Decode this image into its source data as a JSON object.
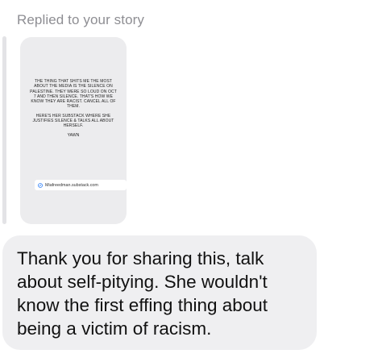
{
  "reply_header": "Replied to your story",
  "story": {
    "paragraphs": [
      "THE THING THAT SHITS ME THE MOST ABOUT THE MEDIA IS THE SILENCE ON PALESTINE. THEY WERE SO LOUD ON OCT 7 AND THEN SILENCE. THAT'S HOW WE KNOW THEY ARE RACIST. CANCEL ALL OF THEM.",
      "HERE'S HER SUBSTACK WHERE SHE JUSTIFIES SILENCE & TALKS ALL ABOUT HERSELF.",
      "YAWN"
    ],
    "link_text": "Miafreedman.substack.com",
    "link_icon": "link-icon"
  },
  "message": {
    "text": "Thank you for sharing this, talk about self-pitying.  She wouldn't know the first effing thing about being a victim of racism."
  }
}
